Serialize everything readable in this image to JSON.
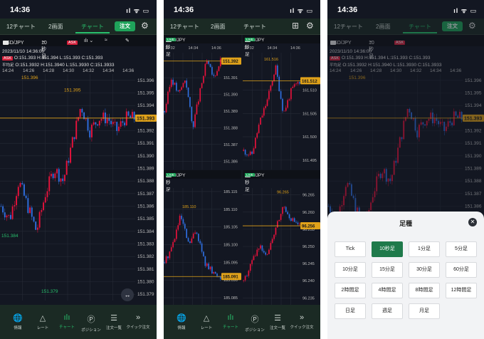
{
  "status": {
    "time": "14:36",
    "icons": "ıl ᯤ ▭"
  },
  "header": {
    "tabs": [
      {
        "label": "12チャート"
      },
      {
        "label": "2画面"
      },
      {
        "label": "チャート"
      }
    ],
    "order_button": "注文"
  },
  "toolbar": {
    "pair": "USD/JPY",
    "interval": "10秒足",
    "ask": "ASK"
  },
  "info": {
    "datetime": "2023/11/10 14:36:00",
    "ask_label": "ASK",
    "ask_values": "O:151.393  H:151.394  L:151.393  C:151.393",
    "avg_label": "平均足",
    "avg_values": "O:151.3932  H:151.3940  L:151.3930  C:151.3933"
  },
  "x_ticks": [
    "14:24",
    "14:26",
    "14:28",
    "14:30",
    "14:32",
    "14:34",
    "14:36"
  ],
  "mini_x_ticks": [
    "14:32",
    "14:34",
    "14:36"
  ],
  "nav": [
    {
      "label": "情報",
      "icon": "globe-icon",
      "glyph": "🌐"
    },
    {
      "label": "レート",
      "icon": "rate-icon",
      "glyph": "△"
    },
    {
      "label": "チャート",
      "icon": "chart-icon",
      "glyph": "ıǀı"
    },
    {
      "label": "ポジション",
      "icon": "position-icon",
      "glyph": "Ⓟ"
    },
    {
      "label": "注文一覧",
      "icon": "list-icon",
      "glyph": "☰"
    },
    {
      "label": "クイック注文",
      "icon": "quick-order-icon",
      "glyph": "»"
    }
  ],
  "chart_data": [
    {
      "type": "candlestick",
      "pair": "USD/JPY",
      "y_ticks": [
        151.396,
        151.395,
        151.394,
        151.393,
        151.392,
        151.391,
        151.39,
        151.389,
        151.388,
        151.387,
        151.386,
        151.385,
        151.384,
        151.383,
        151.382,
        151.381,
        151.38,
        151.379
      ],
      "annotations": {
        "high": "151.396",
        "high2": "151.395",
        "low_mid": "151.384",
        "low": "151.379"
      },
      "current_price": "151.393",
      "ylim": [
        151.3785,
        151.3965
      ],
      "x": [
        "14:24",
        "14:36"
      ],
      "close_path": [
        151.386,
        151.385,
        151.388,
        151.386,
        151.384,
        151.387,
        151.389,
        151.388,
        151.391,
        151.394,
        151.392,
        151.393,
        151.393,
        151.392,
        151.393,
        151.393
      ]
    },
    {
      "type": "candlestick",
      "pair": "USD/JPY",
      "interval": "10秒足",
      "y_ticks": [
        151.392,
        151.391,
        151.39,
        151.389,
        151.388,
        151.387,
        151.386
      ],
      "current_price": "151.392",
      "ylim": [
        151.3855,
        151.3925
      ],
      "close_path": [
        151.389,
        151.391,
        151.39,
        151.391,
        151.388,
        151.39,
        151.392,
        151.391,
        151.392
      ]
    },
    {
      "type": "candlestick",
      "pair": "EUR/JPY",
      "interval": "10秒足",
      "y_ticks": [
        161.51,
        161.505,
        161.5,
        161.495
      ],
      "annotations": {
        "high": "161.516"
      },
      "current_price": "161.512",
      "ylim": [
        161.493,
        161.518
      ],
      "close_path": [
        161.497,
        161.496,
        161.503,
        161.508,
        161.515,
        161.505,
        161.51,
        161.512
      ]
    },
    {
      "type": "candlestick",
      "pair": "GBP/JPY",
      "interval": "10秒足",
      "y_ticks": [
        185.115,
        185.11,
        185.105,
        185.1,
        185.095,
        185.09,
        185.085
      ],
      "annotations": {
        "high": "185.110"
      },
      "current_price": "185.091",
      "ylim": [
        185.083,
        185.116
      ],
      "close_path": [
        185.095,
        185.1,
        185.108,
        185.1,
        185.104,
        185.095,
        185.092,
        185.091
      ]
    },
    {
      "type": "candlestick",
      "pair": "AUD/JPY",
      "interval": "10秒足",
      "y_ticks": [
        96.265,
        96.26,
        96.255,
        96.25,
        96.245,
        96.24,
        96.235
      ],
      "annotations": {
        "high": "96.265"
      },
      "current_price": "96.256",
      "ylim": [
        96.233,
        96.267
      ],
      "close_path": [
        96.24,
        96.245,
        96.25,
        96.248,
        96.255,
        96.262,
        96.258,
        96.256
      ]
    }
  ],
  "sheet": {
    "title": "足種",
    "options": [
      "Tick",
      "10秒足",
      "1分足",
      "5分足",
      "10分足",
      "15分足",
      "30分足",
      "60分足",
      "2時間足",
      "4時間足",
      "8時間足",
      "12時間足",
      "日足",
      "週足",
      "月足"
    ],
    "selected": "10秒足"
  },
  "colors": {
    "up": "#e8123c",
    "down": "#2f6fe0",
    "accent": "#28c06c",
    "price_line": "#e0a21a"
  }
}
